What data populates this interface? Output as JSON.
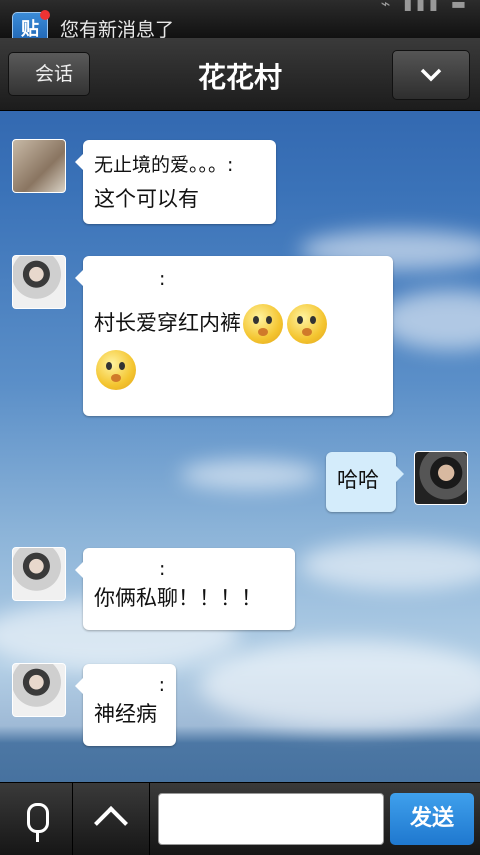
{
  "status_bar": {
    "notification_icon_label": "贴",
    "notification_text": "您有新消息了"
  },
  "header": {
    "back_label": "会话",
    "title": "花花村",
    "dropdown_icon": "chevron-down-icon"
  },
  "messages": [
    {
      "side": "left",
      "sender": "无止境的爱。。。:",
      "text": "这个可以有"
    },
    {
      "side": "left",
      "sender": ":",
      "text": "村长爱穿红内裤",
      "emoji_count": 3
    },
    {
      "side": "right",
      "text": "哈哈"
    },
    {
      "side": "left",
      "sender": ":",
      "text": "你俩私聊！！！！"
    },
    {
      "side": "left",
      "sender": ":",
      "text": "神经病"
    }
  ],
  "footer": {
    "voice_icon": "microphone-icon",
    "expand_icon": "chevron-up-icon",
    "input_placeholder": "",
    "send_label": "发送"
  }
}
